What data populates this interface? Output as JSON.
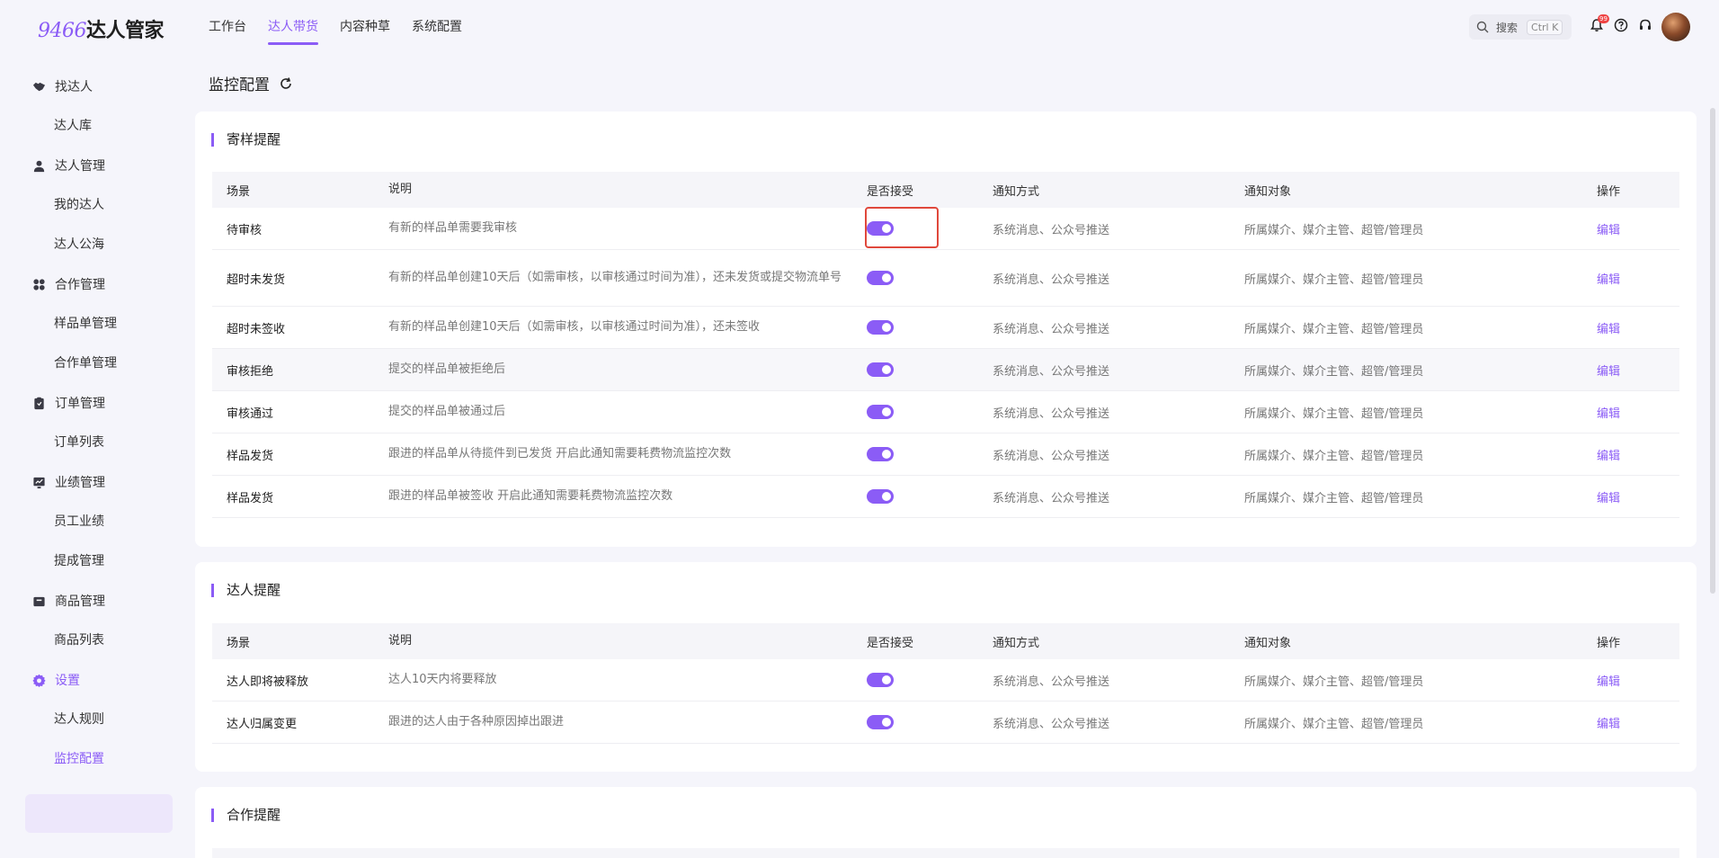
{
  "header": {
    "logo_num": "9466",
    "logo_text": "达人管家",
    "nav": [
      {
        "label": "工作台"
      },
      {
        "label": "达人带货"
      },
      {
        "label": "内容种草"
      },
      {
        "label": "系统配置"
      }
    ],
    "search_label": "搜索",
    "search_shortcut": "Ctrl K",
    "notification_count": "99"
  },
  "sidebar": {
    "groups": [
      {
        "label": "找达人",
        "icon": "handshake-icon",
        "items": [
          {
            "label": "达人库"
          }
        ]
      },
      {
        "label": "达人管理",
        "icon": "user-icon",
        "items": [
          {
            "label": "我的达人"
          },
          {
            "label": "达人公海"
          }
        ]
      },
      {
        "label": "合作管理",
        "icon": "grid-icon",
        "items": [
          {
            "label": "样品单管理"
          },
          {
            "label": "合作单管理"
          }
        ]
      },
      {
        "label": "订单管理",
        "icon": "clipboard-icon",
        "items": [
          {
            "label": "订单列表"
          }
        ]
      },
      {
        "label": "业绩管理",
        "icon": "chart-icon",
        "items": [
          {
            "label": "员工业绩"
          },
          {
            "label": "提成管理"
          }
        ]
      },
      {
        "label": "商品管理",
        "icon": "box-icon",
        "items": [
          {
            "label": "商品列表"
          }
        ]
      },
      {
        "label": "设置",
        "icon": "gear-icon",
        "items": [
          {
            "label": "达人规则"
          },
          {
            "label": "监控配置"
          }
        ]
      }
    ]
  },
  "page": {
    "title": "监控配置"
  },
  "columns": {
    "scene": "场景",
    "desc": "说明",
    "accept": "是否接受",
    "method": "通知方式",
    "target": "通知对象",
    "action": "操作"
  },
  "sections": [
    {
      "title": "寄样提醒",
      "rows": [
        {
          "scene": "待审核",
          "desc": "有新的样品单需要我审核",
          "accept": true,
          "method": "系统消息、公众号推送",
          "target": "所属媒介、媒介主管、超管/管理员",
          "action": "编辑"
        },
        {
          "scene": "超时未发货",
          "desc": "有新的样品单创建10天后（如需审核，以审核通过时间为准），还未发货或提交物流单号",
          "accept": true,
          "method": "系统消息、公众号推送",
          "target": "所属媒介、媒介主管、超管/管理员",
          "action": "编辑"
        },
        {
          "scene": "超时未签收",
          "desc": "有新的样品单创建10天后（如需审核，以审核通过时间为准），还未签收",
          "accept": true,
          "method": "系统消息、公众号推送",
          "target": "所属媒介、媒介主管、超管/管理员",
          "action": "编辑"
        },
        {
          "scene": "审核拒绝",
          "desc": "提交的样品单被拒绝后",
          "accept": true,
          "method": "系统消息、公众号推送",
          "target": "所属媒介、媒介主管、超管/管理员",
          "action": "编辑"
        },
        {
          "scene": "审核通过",
          "desc": "提交的样品单被通过后",
          "accept": true,
          "method": "系统消息、公众号推送",
          "target": "所属媒介、媒介主管、超管/管理员",
          "action": "编辑"
        },
        {
          "scene": "样品发货",
          "desc": "跟进的样品单从待揽件到已发货 开启此通知需要耗费物流监控次数",
          "accept": true,
          "method": "系统消息、公众号推送",
          "target": "所属媒介、媒介主管、超管/管理员",
          "action": "编辑"
        },
        {
          "scene": "样品发货",
          "desc": "跟进的样品单被签收 开启此通知需要耗费物流监控次数",
          "accept": true,
          "method": "系统消息、公众号推送",
          "target": "所属媒介、媒介主管、超管/管理员",
          "action": "编辑"
        }
      ]
    },
    {
      "title": "达人提醒",
      "rows": [
        {
          "scene": "达人即将被释放",
          "desc": "达人10天内将要释放",
          "accept": true,
          "method": "系统消息、公众号推送",
          "target": "所属媒介、媒介主管、超管/管理员",
          "action": "编辑"
        },
        {
          "scene": "达人归属变更",
          "desc": "跟进的达人由于各种原因掉出跟进",
          "accept": true,
          "method": "系统消息、公众号推送",
          "target": "所属媒介、媒介主管、超管/管理员",
          "action": "编辑"
        }
      ]
    },
    {
      "title": "合作提醒",
      "rows": []
    }
  ],
  "colors": {
    "accent": "#8b5cf6",
    "highlight_border": "#e0483c"
  }
}
